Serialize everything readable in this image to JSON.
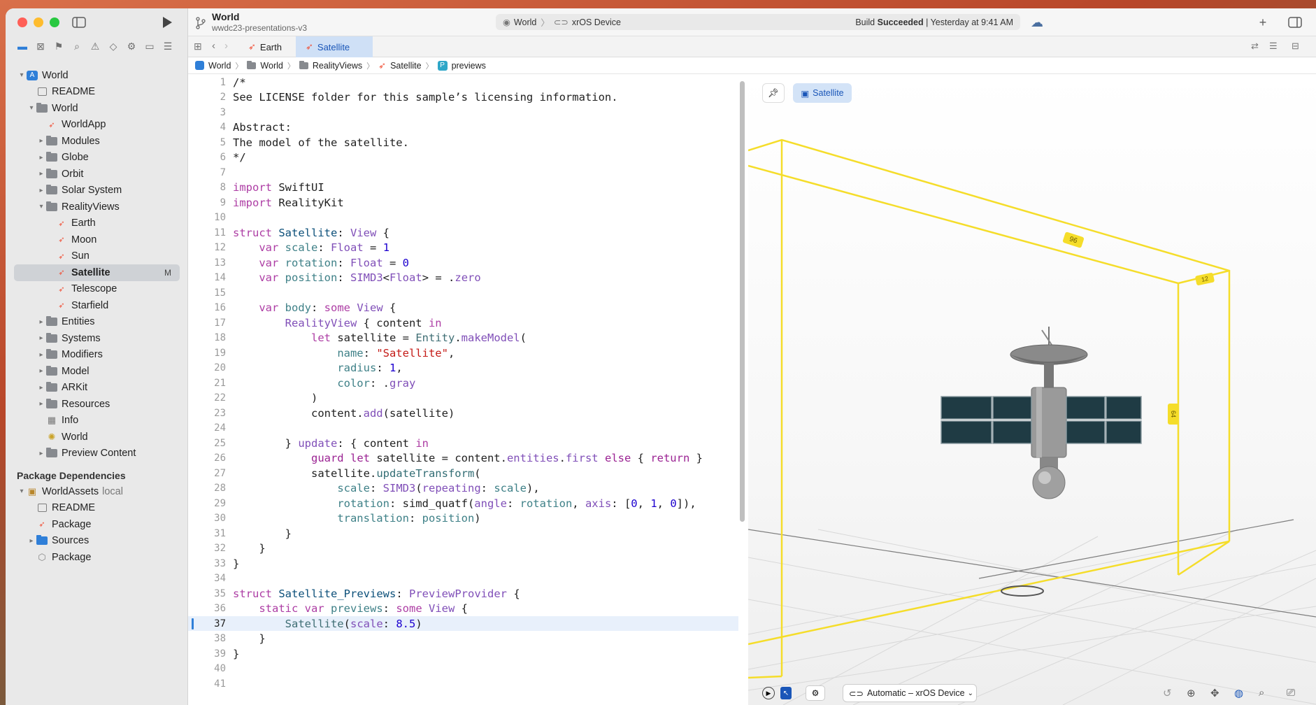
{
  "project": {
    "name": "World",
    "subtitle": "wwdc23-presentations-v3"
  },
  "status": {
    "scheme": "World",
    "device": "xrOS Device",
    "build_prefix": "Build",
    "build_result": "Succeeded",
    "build_time": "| Yesterday at 9:41 AM"
  },
  "tabs": [
    {
      "label": "Earth"
    },
    {
      "label": "Satellite"
    }
  ],
  "breadcrumb": [
    "World",
    "World",
    "RealityViews",
    "Satellite",
    "previews"
  ],
  "sidebar": {
    "items": [
      {
        "label": "World"
      },
      {
        "label": "README"
      },
      {
        "label": "World"
      },
      {
        "label": "WorldApp"
      },
      {
        "label": "Modules"
      },
      {
        "label": "Globe"
      },
      {
        "label": "Orbit"
      },
      {
        "label": "Solar System"
      },
      {
        "label": "RealityViews"
      },
      {
        "label": "Earth"
      },
      {
        "label": "Moon"
      },
      {
        "label": "Sun"
      },
      {
        "label": "Satellite",
        "badge": "M"
      },
      {
        "label": "Telescope"
      },
      {
        "label": "Starfield"
      },
      {
        "label": "Entities"
      },
      {
        "label": "Systems"
      },
      {
        "label": "Modifiers"
      },
      {
        "label": "Model"
      },
      {
        "label": "ARKit"
      },
      {
        "label": "Resources"
      },
      {
        "label": "Info"
      },
      {
        "label": "World"
      },
      {
        "label": "Preview Content"
      }
    ],
    "package_header": "Package Dependencies",
    "packages": [
      {
        "label": "WorldAssets",
        "suffix": "local"
      },
      {
        "label": "README"
      },
      {
        "label": "Package"
      },
      {
        "label": "Sources"
      },
      {
        "label": "Package"
      }
    ]
  },
  "editor": {
    "line_numbers": [
      "1",
      "2",
      "3",
      "4",
      "5",
      "6",
      "7",
      "8",
      "9",
      "10",
      "11",
      "12",
      "13",
      "14",
      "15",
      "16",
      "17",
      "18",
      "19",
      "20",
      "21",
      "22",
      "23",
      "24",
      "25",
      "26",
      "27",
      "28",
      "29",
      "30",
      "31",
      "32",
      "33",
      "34",
      "35",
      "36",
      "37",
      "38",
      "39",
      "40",
      "41"
    ]
  },
  "canvas": {
    "pin_label": "",
    "preview_label": "Satellite",
    "dim_width": "96",
    "dim_depth": "12",
    "dim_height": "64",
    "device_selector": "Automatic – xrOS Device"
  },
  "colors": {
    "accent": "#1a56b8",
    "bounds": "#f5dd2a",
    "tab_active_bg": "#cfe0f6"
  }
}
